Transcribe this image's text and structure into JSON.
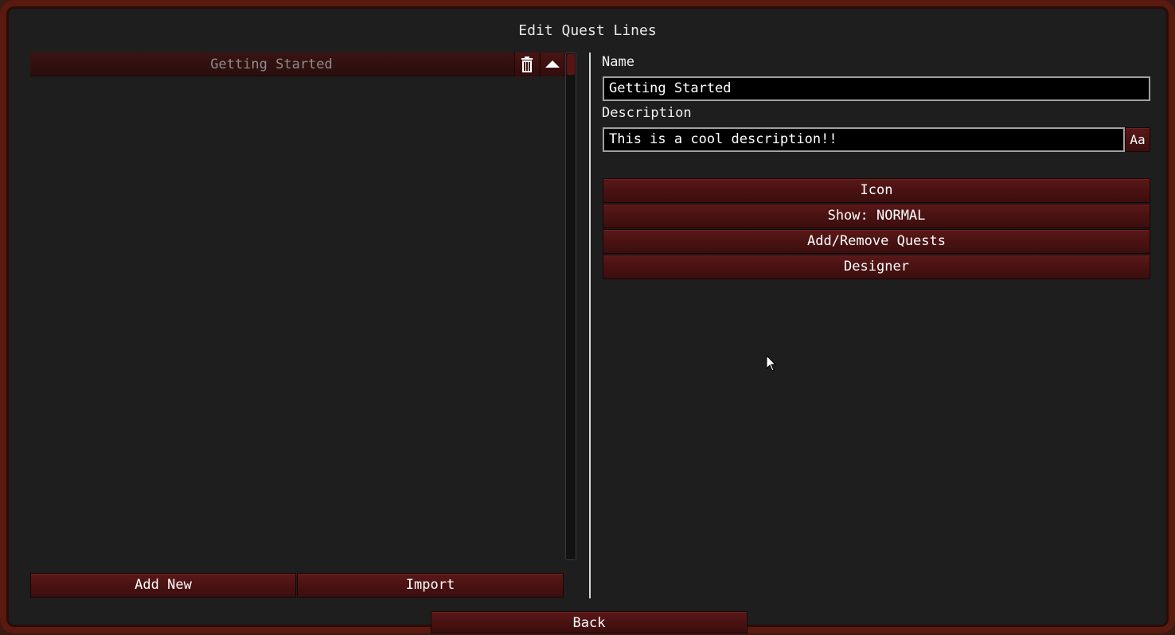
{
  "window": {
    "title": "Edit Quest Lines"
  },
  "quest_lines": {
    "items": [
      {
        "label": "Getting Started"
      }
    ]
  },
  "left_buttons": {
    "add_new": "Add New",
    "import": "Import"
  },
  "fields": {
    "name_label": "Name",
    "name_value": "Getting Started",
    "description_label": "Description",
    "description_value": "This is a cool description!!",
    "format_button": "Aa"
  },
  "actions": {
    "icon": "Icon",
    "show": "Show: NORMAL",
    "add_remove": "Add/Remove Quests",
    "designer": "Designer"
  },
  "footer": {
    "back": "Back"
  },
  "icons": {
    "delete": "trash-icon",
    "move_up": "arrow-up-icon",
    "pointer": "mouse-cursor-icon"
  },
  "colors": {
    "button_red": "#4a1212",
    "frame_border": "#5a1a10",
    "background": "#1e1e1e"
  }
}
